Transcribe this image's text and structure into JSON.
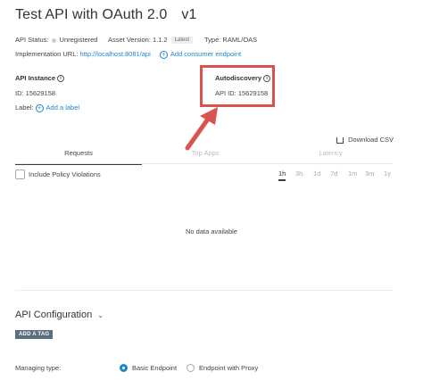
{
  "header": {
    "title": "Test API with OAuth 2.0",
    "version": "v1"
  },
  "meta": {
    "status_label": "API Status:",
    "status_value": "Unregistered",
    "asset_label": "Asset Version: 1.1.2",
    "latest_badge": "Latest",
    "type_label": "Type: RAML/OAS"
  },
  "implementation": {
    "label": "Implementation URL:",
    "url": "http://localhost:8081/api",
    "add_endpoint": "Add consumer endpoint"
  },
  "instance": {
    "heading": "API Instance",
    "id_text": "ID: 15629158",
    "label_text": "Label:",
    "add_label": "Add a label"
  },
  "autodiscovery": {
    "heading": "Autodiscovery",
    "api_id_text": "API ID: 15629158",
    "highlight_color": "#d9534f"
  },
  "download": {
    "label": "Download CSV"
  },
  "tabs": [
    {
      "label": "Requests"
    },
    {
      "label": "Top Apps"
    },
    {
      "label": "Latency"
    }
  ],
  "filters": {
    "policy_violations": "Include Policy Violations",
    "ranges": [
      "1h",
      "3h",
      "1d",
      "7d",
      "1m",
      "3m",
      "1y"
    ],
    "active_range": "1h"
  },
  "chart": {
    "empty_text": "No data available"
  },
  "configuration": {
    "heading": "API Configuration",
    "add_tag": "ADD A TAG",
    "managing_label": "Managing type:",
    "option_basic": "Basic Endpoint",
    "option_proxy": "Endpoint with Proxy",
    "selected": "Basic Endpoint"
  },
  "colors": {
    "accent": "#1e87c7",
    "tab_underline": "#2d3e50",
    "tag_bg": "#5b6f82"
  }
}
